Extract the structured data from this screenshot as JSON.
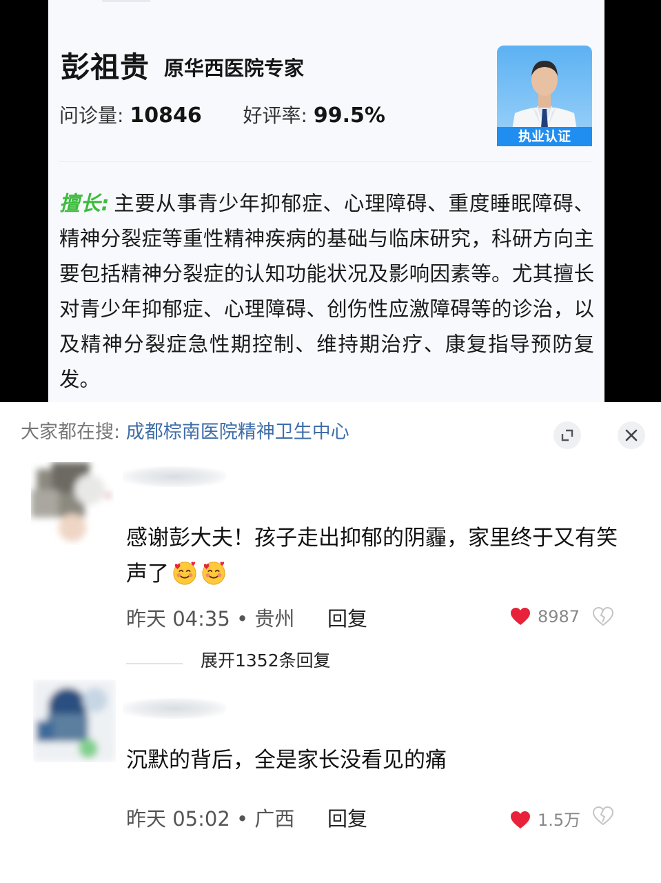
{
  "doctor": {
    "name": "彭祖贵",
    "title": "原华西医院专家",
    "consult_label": "问诊量:",
    "consult_value": "10846",
    "rating_label": "好评率:",
    "rating_value": "99.5%",
    "cert_label": "执业认证",
    "expertise_label": "擅长:",
    "expertise_text": "主要从事青少年抑郁症、心理障碍、重度睡眠障碍、精神分裂症等重性精神疾病的基础与临床研究，科研方向主要包括精神分裂症的认知功能状况及影响因素等。尤其擅长对青少年抑郁症、心理障碍、创伤性应激障碍等的诊治，以及精神分裂症急性期控制、维持期治疗、康复指导预防复发。"
  },
  "search": {
    "label": "大家都在搜:",
    "term": "成都棕南医院精神卫生中心",
    "expand_icon": "expand-icon",
    "close_icon": "close-icon"
  },
  "comments": [
    {
      "text": "感谢彭大夫！孩子走出抑郁的阴霾，家里终于又有笑声了",
      "emoji": [
        "smiling-face-with-hearts",
        "smiling-face-with-hearts"
      ],
      "time": "昨天 04:35",
      "location": "贵州",
      "reply_label": "回复",
      "likes": "8987",
      "expand_label": "展开1352条回复"
    },
    {
      "text": "沉默的背后，全是家长没看见的痛",
      "time": "昨天 05:02",
      "location": "广西",
      "reply_label": "回复",
      "likes": "1.5万"
    }
  ],
  "colors": {
    "like_heart": "#e8223a",
    "search_term": "#3f6ea8",
    "expertise_label": "#3dbc3d",
    "cert_bg": "#1f8ef0"
  }
}
